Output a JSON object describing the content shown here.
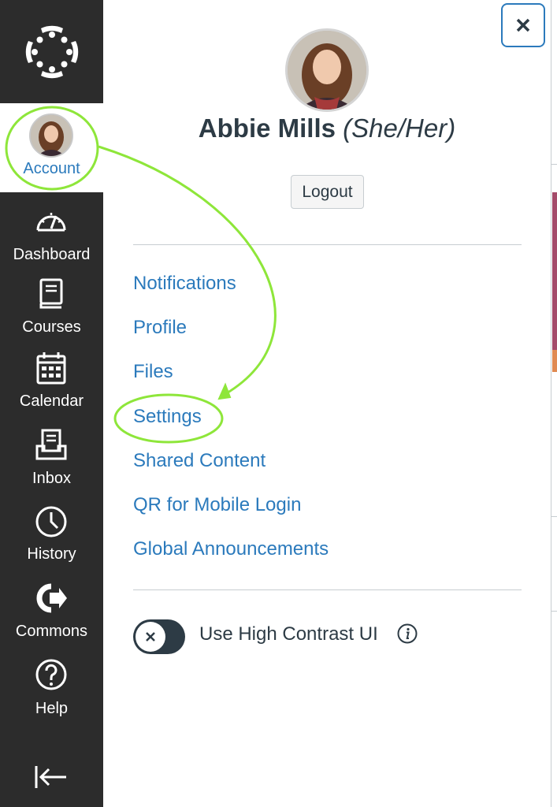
{
  "nav": {
    "logo_icon": "canvas-logo-icon",
    "account_label": "Account",
    "items": [
      {
        "label": "Dashboard",
        "icon": "dashboard-icon"
      },
      {
        "label": "Courses",
        "icon": "courses-icon"
      },
      {
        "label": "Calendar",
        "icon": "calendar-icon"
      },
      {
        "label": "Inbox",
        "icon": "inbox-icon"
      },
      {
        "label": "History",
        "icon": "history-icon"
      },
      {
        "label": "Commons",
        "icon": "commons-icon"
      },
      {
        "label": "Help",
        "icon": "help-icon"
      }
    ],
    "collapse_icon": "collapse-nav-icon"
  },
  "tray": {
    "close_icon": "close-icon",
    "user_name": "Abbie Mills",
    "pronouns": "(She/Her)",
    "logout_label": "Logout",
    "links": [
      "Notifications",
      "Profile",
      "Files",
      "Settings",
      "Shared Content",
      "QR for Mobile Login",
      "Global Announcements"
    ],
    "high_contrast_label": "Use High Contrast UI",
    "high_contrast_enabled": false
  },
  "colors": {
    "nav_background": "#2c2c2c",
    "link": "#2b7abc",
    "annotation": "#8ee63a"
  }
}
